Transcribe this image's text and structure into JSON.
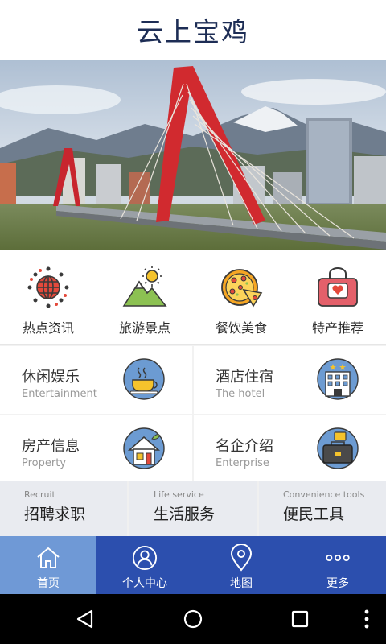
{
  "header": {
    "title": "云上宝鸡"
  },
  "banner": {
    "image": "city-cable-bridge-photo"
  },
  "quick_menu": [
    {
      "label": "热点资讯",
      "icon": "globe-icon"
    },
    {
      "label": "旅游景点",
      "icon": "mountain-sun-icon"
    },
    {
      "label": "餐饮美食",
      "icon": "pizza-icon"
    },
    {
      "label": "特产推荐",
      "icon": "gift-bag-icon"
    }
  ],
  "cards": [
    {
      "title": "休闲娱乐",
      "subtitle": "Entertainment",
      "icon": "coffee-cup-icon"
    },
    {
      "title": "酒店住宿",
      "subtitle": "The hotel",
      "icon": "hotel-building-icon"
    },
    {
      "title": "房产信息",
      "subtitle": "Property",
      "icon": "house-icon"
    },
    {
      "title": "名企介绍",
      "subtitle": "Enterprise",
      "icon": "briefcase-icon"
    }
  ],
  "services": [
    {
      "en": "Recruit",
      "cn": "招聘求职"
    },
    {
      "en": "Life service",
      "cn": "生活服务"
    },
    {
      "en": "Convenience tools",
      "cn": "便民工具"
    }
  ],
  "tabs": [
    {
      "label": "首页",
      "icon": "home-icon",
      "active": true
    },
    {
      "label": "个人中心",
      "icon": "user-icon",
      "active": false
    },
    {
      "label": "地图",
      "icon": "map-pin-icon",
      "active": false
    },
    {
      "label": "更多",
      "icon": "more-dots-icon",
      "active": false
    }
  ],
  "colors": {
    "title": "#1d2d55",
    "tab_bar": "#2c4fae",
    "tab_active": "#6f99d6",
    "icon_circle": "#6c9bd2"
  }
}
